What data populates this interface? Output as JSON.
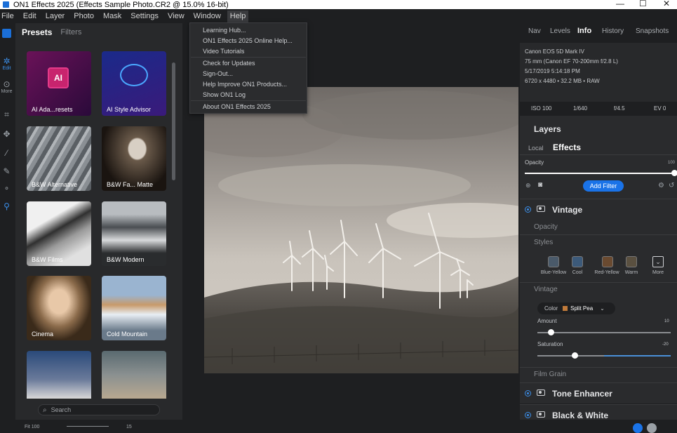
{
  "window": {
    "title": "ON1 Effects 2025 (Effects Sample Photo.CR2 @ 15.0% 16-bit)",
    "controls": [
      "—",
      "☐",
      "✕"
    ]
  },
  "menubar": [
    "File",
    "Edit",
    "Layer",
    "Photo",
    "Mask",
    "Settings",
    "View",
    "Window",
    "Help"
  ],
  "toolstrip": {
    "edit_label": "Edit",
    "more_label": "More"
  },
  "presets": {
    "tab_active": "Presets",
    "tab_other": "Filters",
    "items": [
      {
        "label": "AI Ada...resets",
        "badge": "AI"
      },
      {
        "label": "AI Style Advisor"
      },
      {
        "label": "B&W Alternative"
      },
      {
        "label": "B&W Fa... Matte"
      },
      {
        "label": "B&W Films"
      },
      {
        "label": "B&W Modern"
      },
      {
        "label": "Cinema"
      },
      {
        "label": "Cold Mountain"
      }
    ],
    "search_placeholder": "Search"
  },
  "help_menu": {
    "items": [
      "Learning Hub...",
      "ON1 Effects 2025 Online Help...",
      "Video Tutorials",
      "Check for Updates",
      "Sign-Out...",
      "Help Improve ON1 Products...",
      "Show ON1 Log",
      "About ON1 Effects 2025"
    ]
  },
  "right_tabs": {
    "nav": "Nav",
    "levels": "Levels",
    "info": "Info",
    "history": "History",
    "snapshots": "Snapshots"
  },
  "info": {
    "camera": "Canon EOS 5D Mark IV",
    "lens": "75 mm (Canon EF 70-200mm f/2.8 L)",
    "date": "5/17/2019 5:14:18 PM",
    "dims": "6720 x 4480 • 32.2 MB • RAW",
    "iso": "ISO 100",
    "shutter": "1/640",
    "aperture": "f/4.5",
    "ev": "EV 0"
  },
  "layers": {
    "title": "Layers",
    "tab_local": "Local",
    "tab_effects": "Effects",
    "opacity_label": "Opacity",
    "opacity_value": "100",
    "opacity_level": 1.0,
    "add_filter": "Add Filter"
  },
  "vintage": {
    "title": "Vintage",
    "opacity_label": "Opacity",
    "styles_label": "Styles",
    "styles": [
      {
        "name": "Blue-Yellow",
        "color": "#4a5a6a"
      },
      {
        "name": "Cool",
        "color": "#3c5a7a"
      },
      {
        "name": "Red-Yellow",
        "color": "#6a4a30"
      },
      {
        "name": "Warm",
        "color": "#5a5040"
      },
      {
        "name": "More"
      }
    ],
    "sub_label": "Vintage",
    "color_label": "Color",
    "color_value": "Split Pea",
    "swatch_color": "#c07a3a",
    "amount_label": "Amount",
    "amount_value": "10",
    "amount_level": 0.1,
    "saturation_label": "Saturation",
    "saturation_value": "-20",
    "saturation_level": 0.28,
    "film_grain": "Film Grain"
  },
  "filters_below": [
    "Tone Enhancer",
    "Black & White"
  ],
  "bottom": {
    "left": "Fit 100",
    "right": "15"
  },
  "colors": {
    "accent": "#3b8ee8",
    "button": "#1a73e8"
  }
}
